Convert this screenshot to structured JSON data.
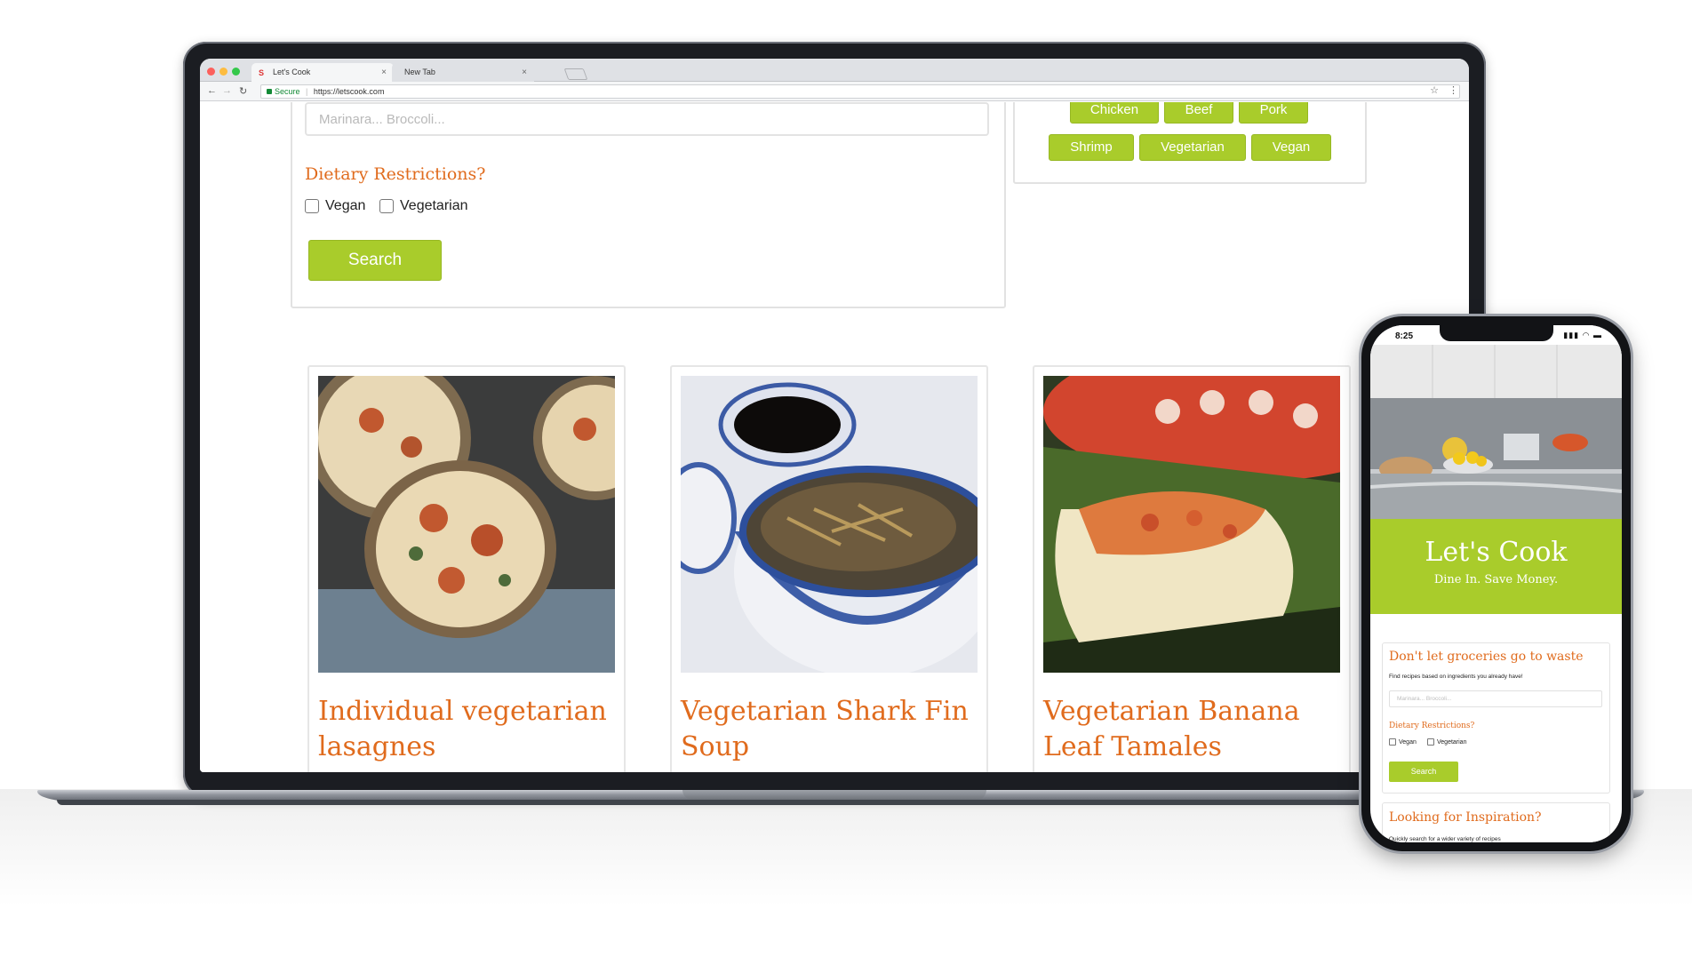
{
  "browser": {
    "tabs": [
      {
        "label": "Let's Cook",
        "favicon": "S",
        "active": true
      },
      {
        "label": "New Tab",
        "active": false
      }
    ],
    "secure_label": "Secure",
    "url": "https://letscook.com"
  },
  "search_form": {
    "ingredients_placeholder": "Marinara... Broccoli...",
    "dietary_title": "Dietary Restrictions?",
    "options": [
      {
        "label": "Vegan",
        "checked": false
      },
      {
        "label": "Vegetarian",
        "checked": false
      }
    ],
    "search_label": "Search"
  },
  "inspiration_tags": [
    "Chicken",
    "Beef",
    "Pork",
    "Shrimp",
    "Vegetarian",
    "Vegan"
  ],
  "recipes": [
    {
      "title": "Individual vegetarian lasagnes"
    },
    {
      "title": "Vegetarian Shark Fin Soup"
    },
    {
      "title": "Vegetarian Banana Leaf Tamales"
    }
  ],
  "mobile": {
    "time": "8:25",
    "brand_title": "Let's Cook",
    "brand_tagline": "Dine In. Save Money.",
    "groceries_title": "Don't let groceries go to waste",
    "groceries_sub": "Find recipes based on ingredients you already have!",
    "ingredients_placeholder": "Marinara... Broccoli...",
    "dietary_title": "Dietary Restrictions?",
    "options": [
      {
        "label": "Vegan"
      },
      {
        "label": "Vegetarian"
      }
    ],
    "search_label": "Search",
    "inspiration_title": "Looking for Inspiration?",
    "inspiration_sub": "Quickly search for a wider variety of recipes"
  },
  "colors": {
    "accent_green": "#a9cc2b",
    "heading_orange": "#e06b1d"
  }
}
